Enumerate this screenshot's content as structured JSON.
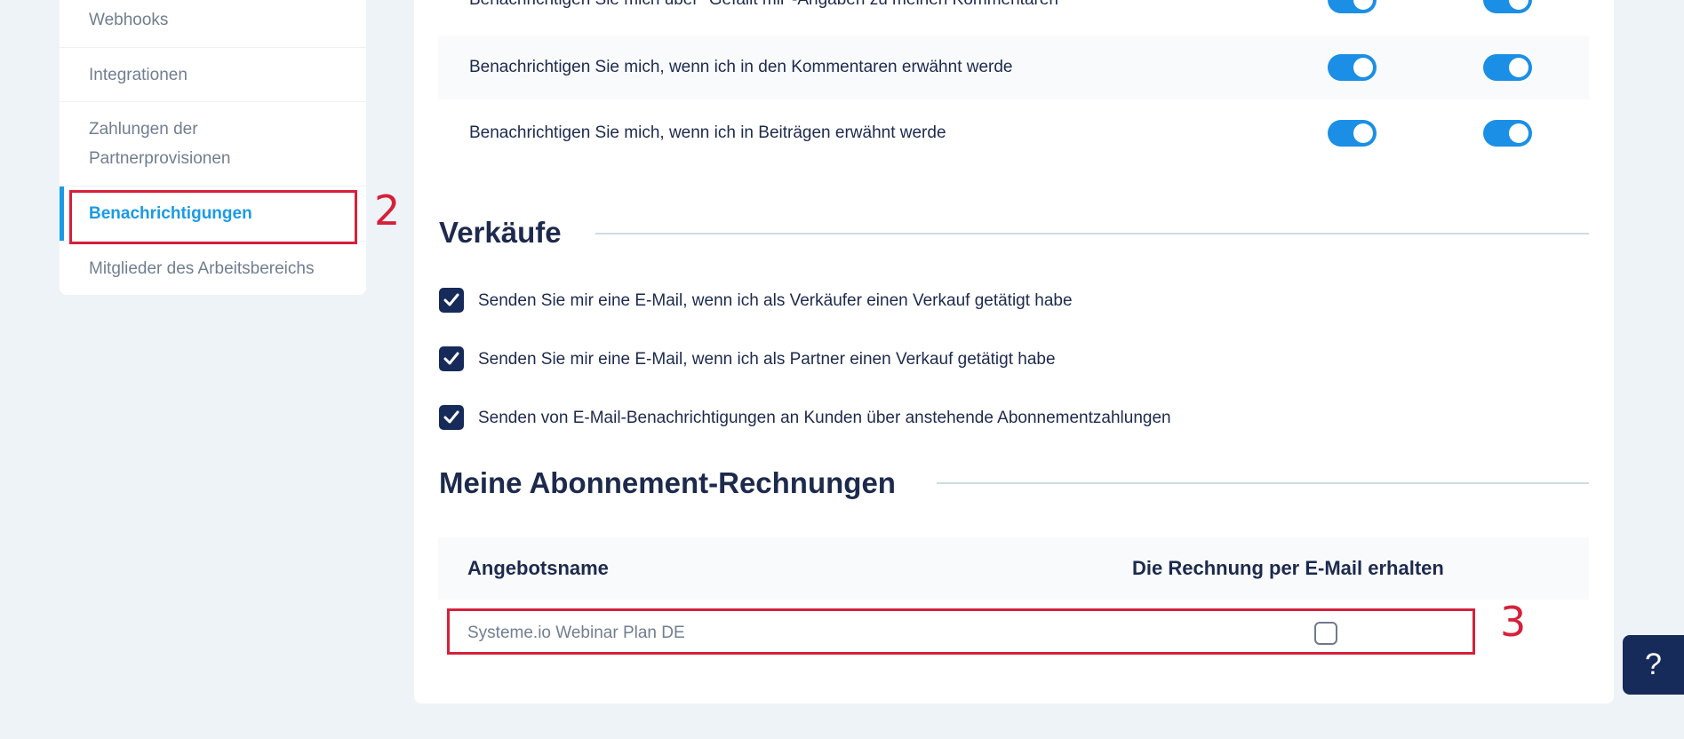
{
  "sidebar": {
    "items": [
      {
        "label": "Webhooks"
      },
      {
        "label": "Integrationen"
      },
      {
        "label": "Zahlungen der Partnerprovisionen"
      },
      {
        "label": "Benachrichtigungen",
        "active": true
      },
      {
        "label": "Mitglieder des Arbeitsbereichs"
      }
    ],
    "accent_color": "#1b9ae6"
  },
  "annotations": {
    "sidebar_marker": "2",
    "row_marker": "3",
    "color": "#d6203a"
  },
  "notifications": {
    "rows": [
      {
        "label": "Benachrichtigen Sie mich über \"Gefällt mir\"-Angaben zu meinen Kommentaren",
        "email_on": true,
        "app_on": true
      },
      {
        "label": "Benachrichtigen Sie mich, wenn ich in den Kommentaren erwähnt werde",
        "email_on": true,
        "app_on": true
      },
      {
        "label": "Benachrichtigen Sie mich, wenn ich in Beiträgen erwähnt werde",
        "email_on": true,
        "app_on": true
      }
    ]
  },
  "sales": {
    "title": "Verkäufe",
    "options": [
      {
        "label": "Senden Sie mir eine E-Mail, wenn ich als Verkäufer einen Verkauf getätigt habe",
        "checked": true
      },
      {
        "label": "Senden Sie mir eine E-Mail, wenn ich als Partner einen Verkauf getätigt habe",
        "checked": true
      },
      {
        "label": "Senden von E-Mail-Benachrichtigungen an Kunden über anstehende Abonnementzahlungen",
        "checked": true
      }
    ]
  },
  "invoices": {
    "title": "Meine Abonnement-Rechnungen",
    "columns": [
      "Angebotsname",
      "Die Rechnung per E-Mail erhalten"
    ],
    "rows": [
      {
        "name": "Systeme.io Webinar Plan DE",
        "receive_email": false
      }
    ]
  },
  "help": {
    "label": "?"
  }
}
